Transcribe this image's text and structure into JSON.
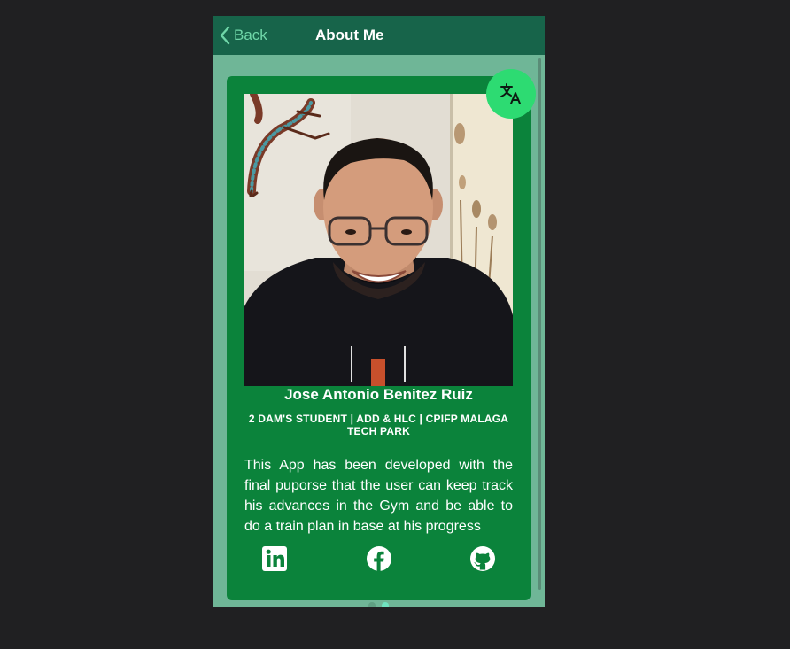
{
  "header": {
    "back_label": "Back",
    "title": "About Me"
  },
  "profile": {
    "photo_alt": "Profile photo",
    "name": "Jose Antonio Benitez Ruiz",
    "subtitle": "2 DAM'S STUDENT | ADD & HLC | CPIFP MALAGA TECH PARK",
    "description": "This App has been developed with the final puporse that the user can keep track his advances in the Gym and be able to do a train plan in base at his progress"
  },
  "socials": [
    {
      "icon": "linkedin-icon"
    },
    {
      "icon": "facebook-icon"
    },
    {
      "icon": "github-icon"
    }
  ],
  "translate_button": {
    "icon": "translate-icon"
  },
  "pager": {
    "count": 2,
    "active_index": 1
  },
  "colors": {
    "background": "#202022",
    "app_background": "#6fb697",
    "header": "#17644a",
    "card": "#0b833b",
    "accent": "#2ddb72",
    "back_text": "#6fd6a8"
  }
}
